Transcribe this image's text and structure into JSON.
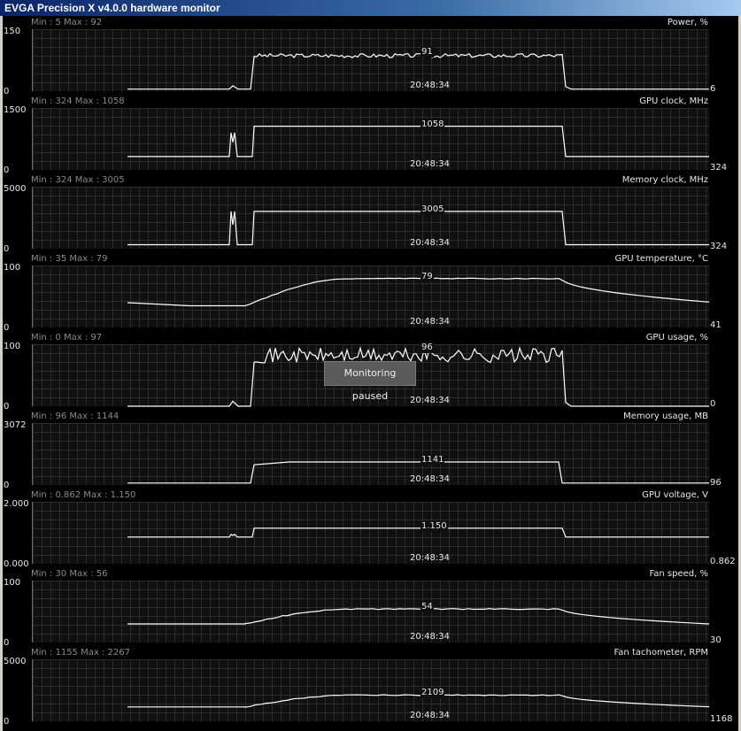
{
  "window": {
    "title": "EVGA Precision X v4.0.0 hardware monitor"
  },
  "time": "20:48:34",
  "tooltip": "Monitoring paused",
  "graphs": [
    {
      "id": "power",
      "title": "Power, %",
      "min": "Min : 5",
      "max": "Max : 92",
      "ymax": "150",
      "ymin": "0",
      "ymax_val": 150,
      "peak": "91",
      "current": "6",
      "pattern": "noisy",
      "base": 5,
      "high": 86,
      "noise": 5
    },
    {
      "id": "gpu-clock",
      "title": "GPU clock, MHz",
      "min": "Min : 324",
      "max": "Max : 1058",
      "ymax": "1500",
      "ymin": "0",
      "ymax_val": 1500,
      "peak": "1058",
      "current": "324",
      "pattern": "step",
      "base": 324,
      "high": 1058,
      "spike": 900
    },
    {
      "id": "memory-clock",
      "title": "Memory clock, MHz",
      "min": "Min : 324",
      "max": "Max : 3005",
      "ymax": "5000",
      "ymin": "0",
      "ymax_val": 5000,
      "peak": "3005",
      "current": "324",
      "pattern": "step",
      "base": 324,
      "high": 3005,
      "spike": 3005
    },
    {
      "id": "gpu-temp",
      "title": "GPU temperature, °C",
      "min": "Min : 35",
      "max": "Max : 79",
      "ymax": "100",
      "ymin": "0",
      "ymax_val": 100,
      "peak": "79",
      "current": "41",
      "pattern": "curve",
      "base": 38,
      "high": 79,
      "start": 40,
      "low": 35,
      "end": 41
    },
    {
      "id": "gpu-usage",
      "title": "GPU usage, %",
      "min": "Min : 0",
      "max": "Max : 97",
      "ymax": "100",
      "ymin": "0",
      "ymax_val": 100,
      "peak": "96",
      "current": "0",
      "pattern": "noisy",
      "base": 0,
      "high": 82,
      "noise": 12
    },
    {
      "id": "memory-usage",
      "title": "Memory usage, MB",
      "min": "Min : 96",
      "max": "Max : 1144",
      "ymax": "3072",
      "ymin": "0",
      "ymax_val": 3072,
      "peak": "1141",
      "current": "96",
      "pattern": "plateau",
      "base": 96,
      "high": 1141,
      "rise": 1000
    },
    {
      "id": "gpu-voltage",
      "title": "GPU voltage, V",
      "min": "Min : 0.862",
      "max": "Max : 1.150",
      "ymax": "2.000",
      "ymin": "0.000",
      "ymax_val": 2.0,
      "peak": "1.150",
      "current": "0.862",
      "pattern": "step",
      "base": 0.862,
      "high": 1.15,
      "spike": 0.95
    },
    {
      "id": "fan-speed",
      "title": "Fan speed, %",
      "min": "Min : 30",
      "max": "Max : 56",
      "ymax": "100",
      "ymin": "0",
      "ymax_val": 100,
      "peak": "54",
      "current": "30",
      "pattern": "curve",
      "base": 30,
      "high": 54,
      "start": 30,
      "low": 30,
      "end": 30
    },
    {
      "id": "fan-tach",
      "title": "Fan tachometer, RPM",
      "min": "Min : 1155",
      "max": "Max : 2267",
      "ymax": "5000",
      "ymin": "0",
      "ymax_val": 5000,
      "peak": "2109",
      "current": "1168",
      "pattern": "curve",
      "base": 1155,
      "high": 2109,
      "start": 1160,
      "low": 1155,
      "end": 1168
    }
  ]
}
